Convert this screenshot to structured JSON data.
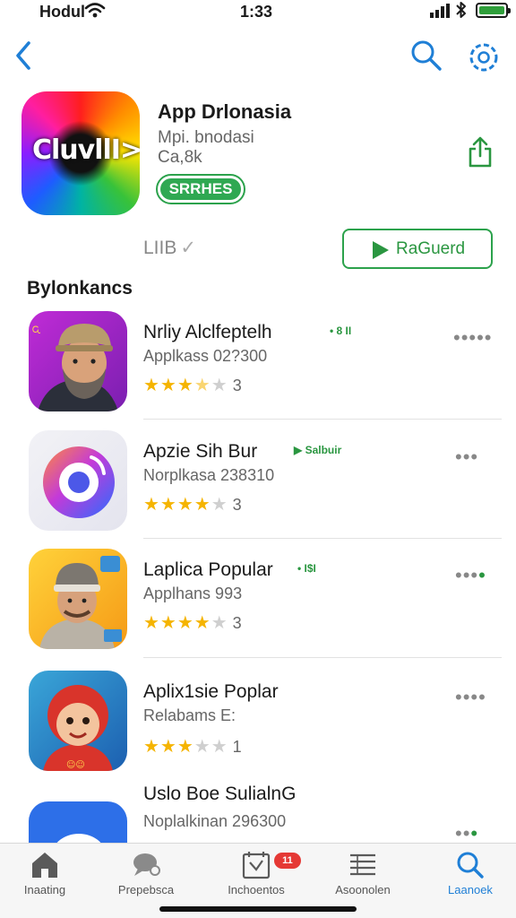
{
  "status_bar": {
    "carrier": "Hodul",
    "time": "1:33"
  },
  "nav": {
    "back_icon": "chevron-left-icon",
    "search_icon": "search-icon",
    "settings_icon": "gear-icon"
  },
  "hero": {
    "icon_text": "CluvllI>",
    "title": "App Drlonasia",
    "developer": "Mpi. bnodasi",
    "count": "Ca,8k",
    "badge": "SRRHES",
    "status": "LIIB",
    "button_label": "RaGuerd",
    "share_icon": "share-icon"
  },
  "section": {
    "title": "Bylonkancs"
  },
  "apps": [
    {
      "name": "Nrliy Alclfeptelh",
      "tag": "• 8 II",
      "subtitle": "Applkass 02?300",
      "stars": "★★★",
      "half": "★",
      "off": "★",
      "rating_value": "3",
      "more": "•••••",
      "more_green": ""
    },
    {
      "name": "Apzie Sih Bur",
      "tag": "▶ Salbuir",
      "subtitle": "Norplkasa 238310",
      "stars": "★★★★",
      "half": "",
      "off": "★",
      "rating_value": "3",
      "more": "•••",
      "more_green": ""
    },
    {
      "name": "Laplica Popular",
      "tag": "• I$I",
      "subtitle": "Applhans 993",
      "stars": "★★★★",
      "half": "",
      "off": "★",
      "rating_value": "3",
      "more": "•••",
      "more_green": "•"
    },
    {
      "name": "Aplix1sie Poplar",
      "tag": "",
      "subtitle": "Relabams E:",
      "stars": "★★★",
      "half": "",
      "off": "★★",
      "rating_value": "1",
      "more": "••••",
      "more_green": ""
    },
    {
      "name": "Uslo Boe SulialnG",
      "tag": "",
      "subtitle": "Noplalkinan 296300",
      "stars": "",
      "half": "",
      "off": "",
      "rating_value": "",
      "more": "••",
      "more_green": "•"
    }
  ],
  "tabbar": {
    "tabs": [
      {
        "label": "Inaating",
        "icon": "home-icon"
      },
      {
        "label": "Prepebsca",
        "icon": "chat-icon"
      },
      {
        "label": "Inchoentos",
        "icon": "calendar-icon"
      },
      {
        "label": "Asoonolen",
        "icon": "list-icon"
      },
      {
        "label": "Laanoek",
        "icon": "search-icon"
      }
    ],
    "badge": "11"
  },
  "colors": {
    "accent_blue": "#1f7fd6",
    "accent_green": "#2a9640",
    "star": "#f5b400",
    "badge_red": "#e53935"
  }
}
